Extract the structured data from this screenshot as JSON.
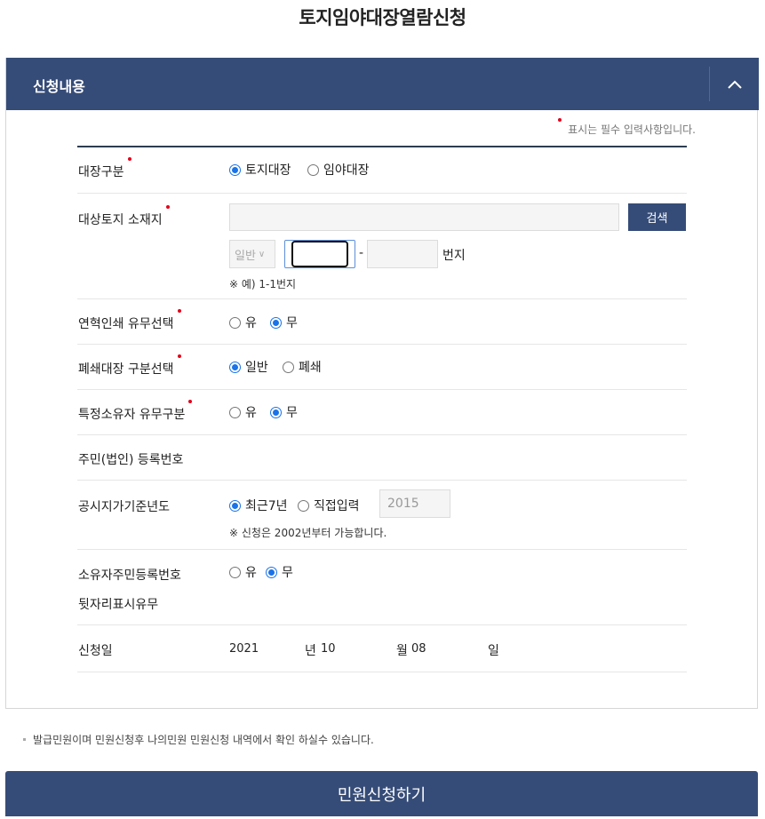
{
  "page": {
    "title": "토지임야대장열람신청"
  },
  "section": {
    "title": "신청내용",
    "collapse_icon": "chevron-up-icon"
  },
  "required_note": "표시는 필수 입력사항입니다.",
  "rows": {
    "ledger_type": {
      "label": "대장구분",
      "options": [
        "토지대장",
        "임야대장"
      ],
      "selected": "토지대장"
    },
    "location": {
      "label": "대상토지 소재지",
      "address_value": "",
      "search_button": "검색",
      "select_value": "일반",
      "main_number": "",
      "sub_number": "",
      "dash": "-",
      "suffix": "번지",
      "example": "※ 예) 1-1번지"
    },
    "history_print": {
      "label": "연혁인쇄 유무선택",
      "options": [
        "유",
        "무"
      ],
      "selected": "무"
    },
    "closed_ledger": {
      "label": "폐쇄대장 구분선택",
      "options": [
        "일반",
        "폐쇄"
      ],
      "selected": "일반"
    },
    "specific_owner": {
      "label": "특정소유자 유무구분",
      "options": [
        "유",
        "무"
      ],
      "selected": "무"
    },
    "resident_number": {
      "label": "주민(법인) 등록번호"
    },
    "land_price_year": {
      "label": "공시지가기준년도",
      "options": [
        "최근7년",
        "직접입력"
      ],
      "selected": "최근7년",
      "year_value": "2015",
      "note": "※ 신청은 2002년부터 가능합니다."
    },
    "owner_id_display": {
      "label_line1": "소유자주민등록번호",
      "label_line2": "뒷자리표시유무",
      "options": [
        "유",
        "무"
      ],
      "selected": "무"
    },
    "apply_date": {
      "label": "신청일",
      "year": "2021",
      "year_unit": "년",
      "month": "10",
      "month_unit": "월",
      "day": "08",
      "day_unit": "일"
    }
  },
  "bottom_note": "발급민원이며 민원신청후 나의민원 민원신청 내역에서 확인 하실수 있습니다.",
  "submit_button": "민원신청하기",
  "colors": {
    "primary": "#364c78",
    "required_dot": "#e3001b",
    "radio_on": "#1a73e8"
  }
}
